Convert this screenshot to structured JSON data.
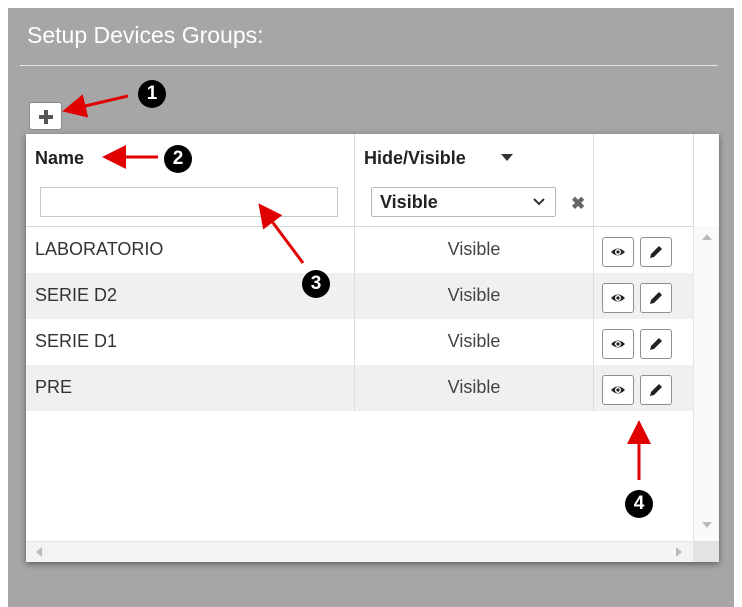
{
  "header": {
    "title": "Setup Devices Groups:"
  },
  "toolbar": {
    "add_icon": "plus-icon"
  },
  "grid": {
    "columns": {
      "name": "Name",
      "visibility": "Hide/Visible"
    },
    "filters": {
      "name_value": "",
      "visibility_selected": "Visible"
    },
    "rows": [
      {
        "name": "LABORATORIO",
        "visibility": "Visible"
      },
      {
        "name": "SERIE D2",
        "visibility": "Visible"
      },
      {
        "name": "SERIE D1",
        "visibility": "Visible"
      },
      {
        "name": "PRE",
        "visibility": "Visible"
      }
    ],
    "row_action_icons": [
      "eye-icon",
      "pencil-icon"
    ]
  },
  "annotations": [
    "1",
    "2",
    "3",
    "4"
  ],
  "colors": {
    "panel_bg": "#a6a6a6",
    "annotation_arrow": "#e00000",
    "annotation_badge": "#000000"
  }
}
